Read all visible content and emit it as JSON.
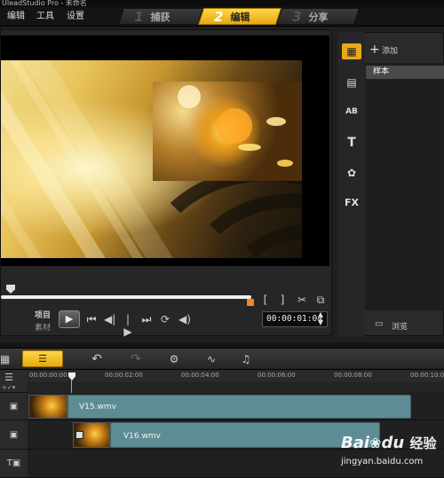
{
  "window": {
    "title": "UIeadStudio Pro - 未命名"
  },
  "menu": [
    "编辑",
    "工具",
    "设置"
  ],
  "steps": [
    {
      "num": "1",
      "label": "捕获",
      "active": false
    },
    {
      "num": "2",
      "label": "编辑",
      "active": true
    },
    {
      "num": "3",
      "label": "分享",
      "active": false
    }
  ],
  "player": {
    "mode_project": "项目",
    "mode_clip": "素材",
    "timecode": "00:00:01:04",
    "progress": 1.0,
    "mark_in": "[",
    "mark_out": "]"
  },
  "library": {
    "add_label": "添加",
    "items": [
      "样本"
    ],
    "browse_label": "浏览",
    "tabs": [
      "media-icon",
      "transition-icon",
      "graphic-icon",
      "title-icon",
      "filter-icon",
      "fx-icon"
    ]
  },
  "timeline": {
    "ruler": [
      "00:00:00:00",
      "00:00:02:00",
      "00:00:04:00",
      "00:00:06:00",
      "00:00:08:00",
      "00:00:10:00"
    ],
    "tracks": [
      {
        "clip": "V15.wmv"
      },
      {
        "clip": "V16.wmv"
      },
      {
        "clip": ""
      }
    ]
  },
  "watermark": {
    "brand": "Bai",
    "brand2": "du",
    "suffix": "经验",
    "url": "jingyan.baidu.com"
  },
  "colors": {
    "accent": "#f0b31e",
    "clip": "#5e8c94",
    "timecode_bg": "#0d0d0d"
  }
}
